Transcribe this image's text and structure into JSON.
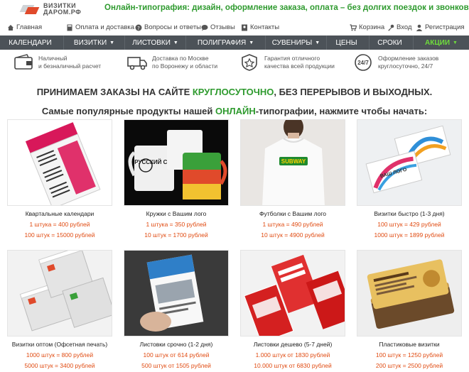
{
  "header": {
    "logo_line1": "ВИЗИТКИ",
    "logo_line2": "ДАРОМ.РФ",
    "tagline": "Онлайн-типография: дизайн, оформление заказа, оплата – без долгих поездок и звонков!"
  },
  "topbar": {
    "home": "Главная",
    "payment": "Оплата и доставка",
    "faq": "Вопросы и ответы",
    "reviews": "Отзывы",
    "contacts": "Контакты",
    "cart": "Корзина",
    "login": "Вход",
    "register": "Регистрация"
  },
  "nav": [
    {
      "label": "КАЛЕНДАРИ",
      "arrow": ""
    },
    {
      "label": "ВИЗИТКИ",
      "arrow": "▼"
    },
    {
      "label": "ЛИСТОВКИ",
      "arrow": "▼"
    },
    {
      "label": "ПОЛИГРАФИЯ",
      "arrow": "▼"
    },
    {
      "label": "СУВЕНИРЫ",
      "arrow": "▼"
    },
    {
      "label": "ЦЕНЫ",
      "arrow": ""
    },
    {
      "label": "СРОКИ",
      "arrow": ""
    },
    {
      "label": "АКЦИИ",
      "arrow": "▼"
    }
  ],
  "features": [
    {
      "line1": "Наличный",
      "line2": "и безналичный расчет",
      "icon": "wallet-icon"
    },
    {
      "line1": "Доставка по Москве",
      "line2": "по Воронежу и области",
      "icon": "truck-icon"
    },
    {
      "line1": "Гарантия отличного",
      "line2": "качества всей продукции",
      "icon": "star-badge-icon"
    },
    {
      "line1": "Оформление заказов",
      "line2": "круглосуточно, 24/7",
      "icon": "clock-24-7-icon"
    }
  ],
  "headline": {
    "part1": "ПРИНИМАЕМ ЗАКАЗЫ НА САЙТЕ ",
    "accent": "КРУГЛОСУТОЧНО",
    "part2": ", БЕЗ ПЕРЕРЫВОВ И ВЫХОДНЫХ."
  },
  "subheadline": {
    "part1": "Самые популярные продукты нашей ",
    "accent": "ОНЛАЙН",
    "part2": "-типографии, нажмите чтобы начать:"
  },
  "products": [
    {
      "name": "Квартальные календари",
      "price1": "1 штука = 400 рублей",
      "price2": "100 штук = 15000 рублей"
    },
    {
      "name": "Кружки с Вашим лого",
      "price1": "1 штука = 350 рублей",
      "price2": "10 штук = 1700 рублей",
      "mug_text": "РУССКИЙ СТАНДАРТ"
    },
    {
      "name": "Футболки с Вашим лого",
      "price1": "1 штука = 490 рублей",
      "price2": "10 штук = 4900 рублей",
      "shirt_text": "SUBWAY"
    },
    {
      "name": "Визитки быстро (1-3 дня)",
      "price1": "100 штук = 429 рублей",
      "price2": "1000 штук = 1899 рублей",
      "card_text": "ВАШ ЛОГО"
    },
    {
      "name": "Визитки оптом (Офсетная печать)",
      "price1": "1000 штук = 800 рублей",
      "price2": "5000 штук = 3400 рублей"
    },
    {
      "name": "Листовки срочно (1-2 дня)",
      "price1": "100 штук от 614 рублей",
      "price2": "500 штук от 1505 рублей"
    },
    {
      "name": "Листовки дешево (5-7 дней)",
      "price1": "1.000 штук от 1830 рублей",
      "price2": "10.000 штук от 6830 рублей"
    },
    {
      "name": "Пластиковые визитки",
      "price1": "100 штук = 1250 рублей",
      "price2": "200 штук = 2500 рублей"
    }
  ],
  "colors": {
    "accent_green": "#2e9a2e",
    "price_orange": "#e04a10",
    "nav_bg": "#4c5258",
    "nav_highlight": "#6fdc3c"
  }
}
